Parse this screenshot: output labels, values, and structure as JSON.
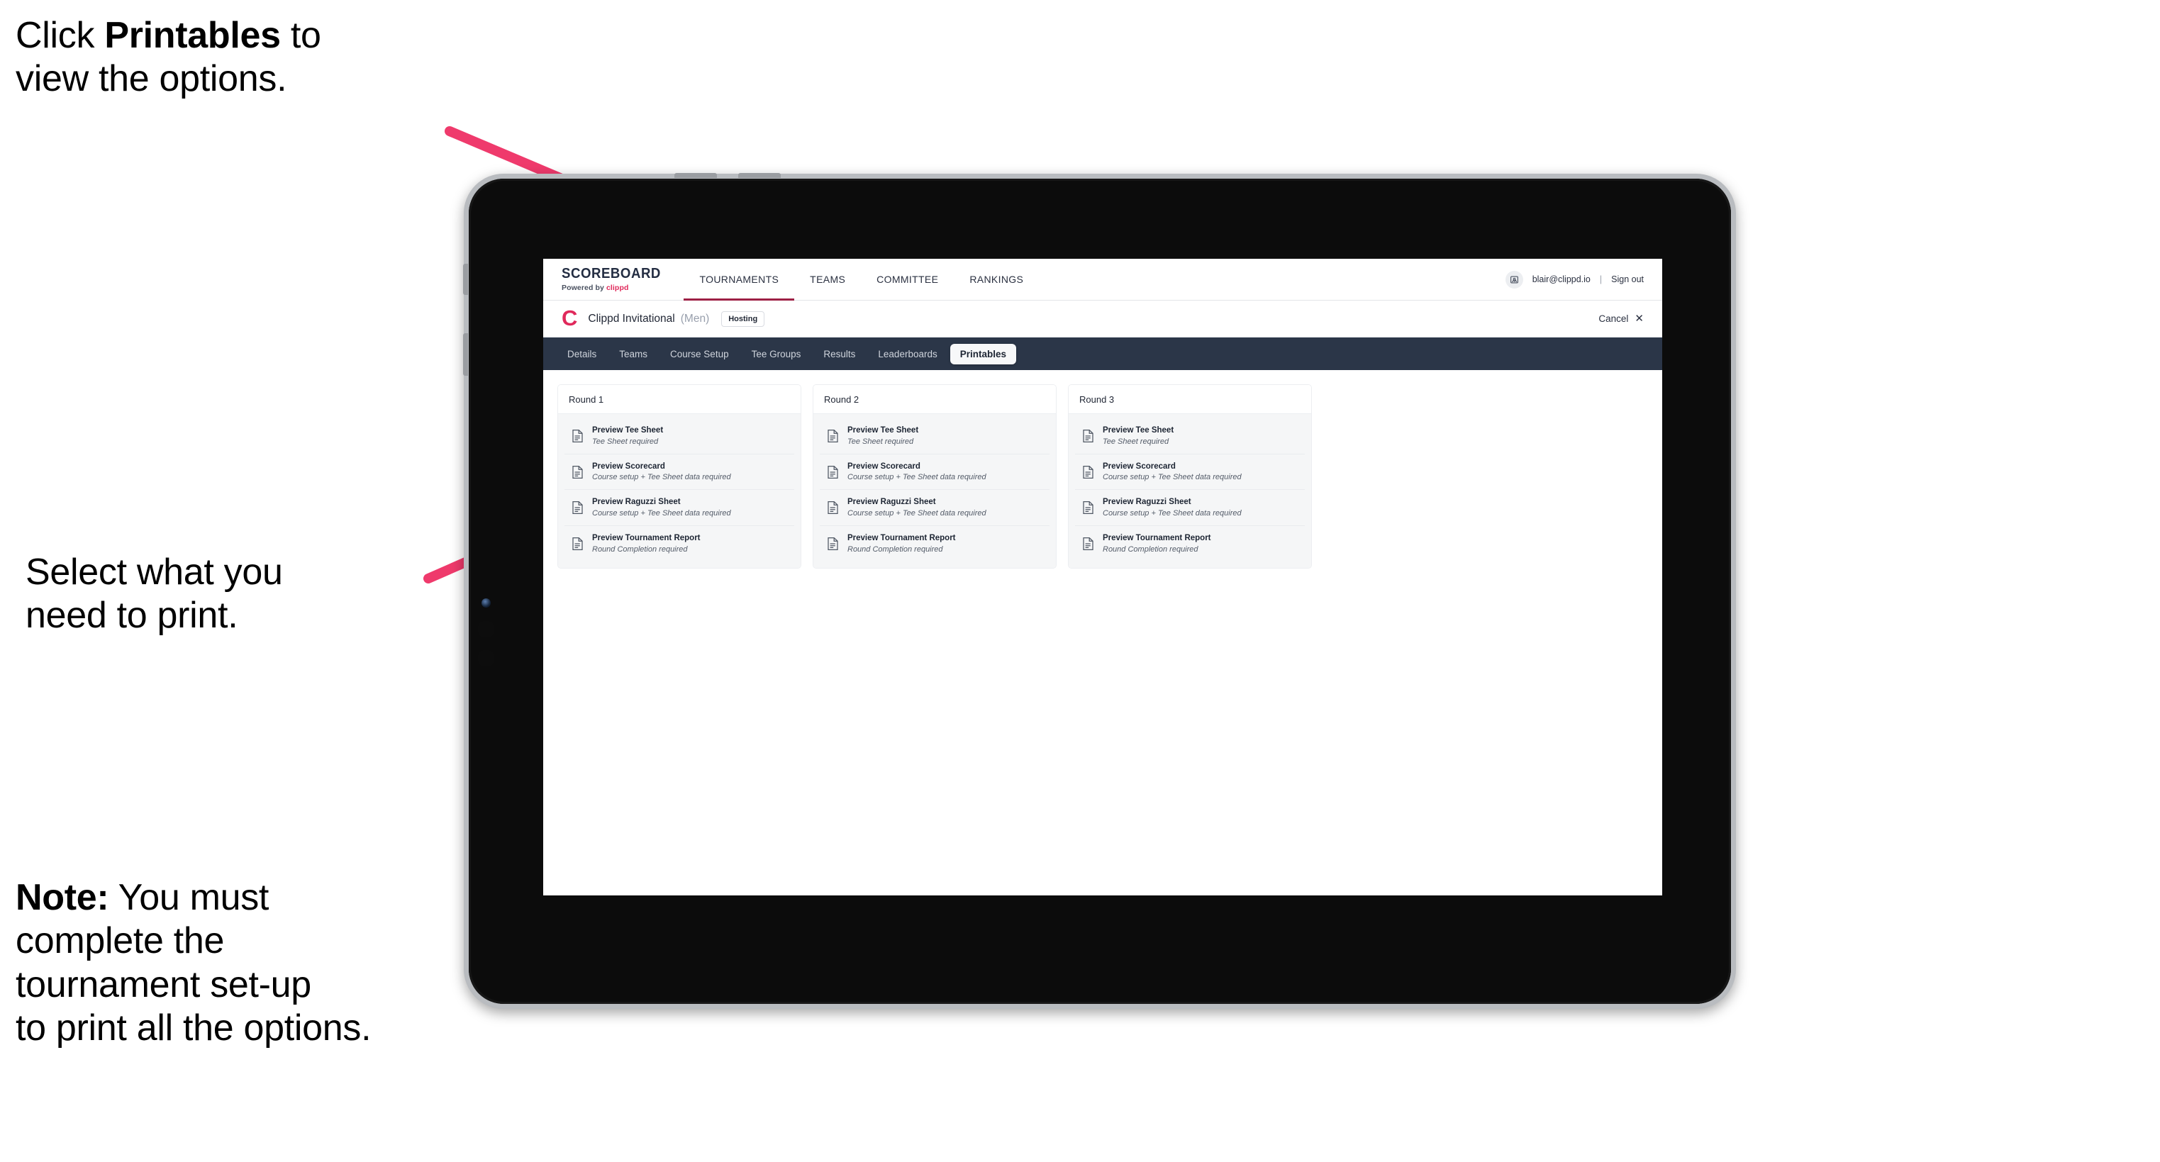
{
  "annotations": {
    "step1_prefix": "Click ",
    "step1_bold": "Printables",
    "step1_suffix": " to\nview the options.",
    "step2": "Select what you\n need to print.",
    "note_bold": "Note:",
    "note_rest": " You must\ncomplete the\ntournament set-up\nto print all the options.",
    "accent_color": "#ef3a6c"
  },
  "browser": {
    "header": {
      "brand_title": "SCOREBOARD",
      "brand_sub_prefix": "Powered by ",
      "brand_sub_accent": "clippd",
      "nav": [
        {
          "label": "TOURNAMENTS",
          "active": true
        },
        {
          "label": "TEAMS",
          "active": false
        },
        {
          "label": "COMMITTEE",
          "active": false
        },
        {
          "label": "RANKINGS",
          "active": false
        }
      ],
      "avatar_icon": "user-avatar-icon",
      "user_email": "blair@clippd.io",
      "divider": "|",
      "sign_out": "Sign out"
    },
    "tournament_bar": {
      "logo_letter": "C",
      "name": "Clippd Invitational",
      "gender": "(Men)",
      "hosting_chip": "Hosting",
      "cancel_label": "Cancel",
      "cancel_icon": "close-icon"
    },
    "tabs": [
      {
        "label": "Details",
        "selected": false
      },
      {
        "label": "Teams",
        "selected": false
      },
      {
        "label": "Course Setup",
        "selected": false
      },
      {
        "label": "Tee Groups",
        "selected": false
      },
      {
        "label": "Results",
        "selected": false
      },
      {
        "label": "Leaderboards",
        "selected": false
      },
      {
        "label": "Printables",
        "selected": true
      }
    ],
    "rounds": [
      {
        "title": "Round 1",
        "items": [
          {
            "icon": "document-icon",
            "title": "Preview Tee Sheet",
            "sub": "Tee Sheet required"
          },
          {
            "icon": "document-icon",
            "title": "Preview Scorecard",
            "sub": "Course setup + Tee Sheet data required"
          },
          {
            "icon": "document-icon",
            "title": "Preview Raguzzi Sheet",
            "sub": "Course setup + Tee Sheet data required"
          },
          {
            "icon": "document-icon",
            "title": "Preview Tournament Report",
            "sub": "Round Completion required"
          }
        ]
      },
      {
        "title": "Round 2",
        "items": [
          {
            "icon": "document-icon",
            "title": "Preview Tee Sheet",
            "sub": "Tee Sheet required"
          },
          {
            "icon": "document-icon",
            "title": "Preview Scorecard",
            "sub": "Course setup + Tee Sheet data required"
          },
          {
            "icon": "document-icon",
            "title": "Preview Raguzzi Sheet",
            "sub": "Course setup + Tee Sheet data required"
          },
          {
            "icon": "document-icon",
            "title": "Preview Tournament Report",
            "sub": "Round Completion required"
          }
        ]
      },
      {
        "title": "Round 3",
        "items": [
          {
            "icon": "document-icon",
            "title": "Preview Tee Sheet",
            "sub": "Tee Sheet required"
          },
          {
            "icon": "document-icon",
            "title": "Preview Scorecard",
            "sub": "Course setup + Tee Sheet data required"
          },
          {
            "icon": "document-icon",
            "title": "Preview Raguzzi Sheet",
            "sub": "Course setup + Tee Sheet data required"
          },
          {
            "icon": "document-icon",
            "title": "Preview Tournament Report",
            "sub": "Round Completion required"
          }
        ]
      }
    ]
  },
  "colors": {
    "nav_dark": "#2b3648",
    "brand_pink": "#e0295b",
    "arrow_pink": "#ef3a6c",
    "tab_active_underline": "#9d2045"
  }
}
